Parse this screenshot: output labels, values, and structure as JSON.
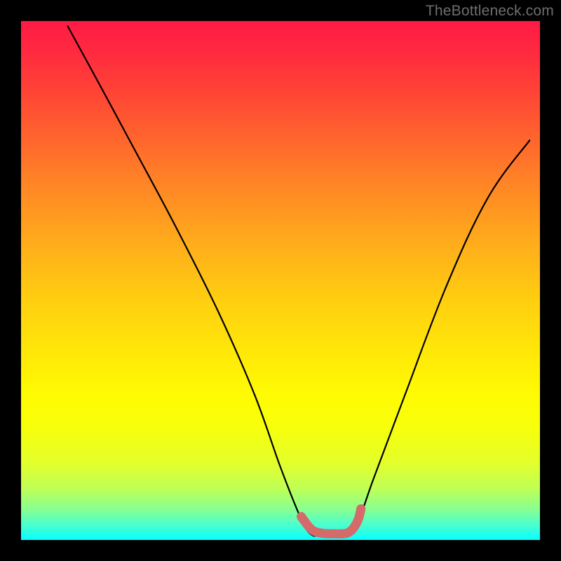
{
  "watermark": "TheBottleneck.com",
  "chart_data": {
    "type": "line",
    "title": "",
    "xlabel": "",
    "ylabel": "",
    "xlim": [
      0,
      100
    ],
    "ylim": [
      0,
      100
    ],
    "series": [
      {
        "name": "bottleneck-curve",
        "x": [
          9,
          15,
          22,
          30,
          38,
          45,
          50,
          54,
          56,
          58,
          62,
          65,
          68,
          74,
          82,
          90,
          98
        ],
        "values": [
          99,
          88,
          75,
          60,
          44,
          28,
          14,
          4,
          1,
          1,
          1,
          4,
          12,
          28,
          49,
          66,
          77
        ]
      }
    ],
    "highlight": {
      "name": "minimum-band",
      "x": [
        54,
        56,
        58,
        60,
        62,
        63,
        64,
        65,
        65.5
      ],
      "values": [
        4.5,
        2.0,
        1.3,
        1.2,
        1.2,
        1.4,
        2.2,
        4.0,
        6.0
      ],
      "color": "#d46a6a",
      "line_width": 13
    },
    "grid": false,
    "legend": false
  }
}
